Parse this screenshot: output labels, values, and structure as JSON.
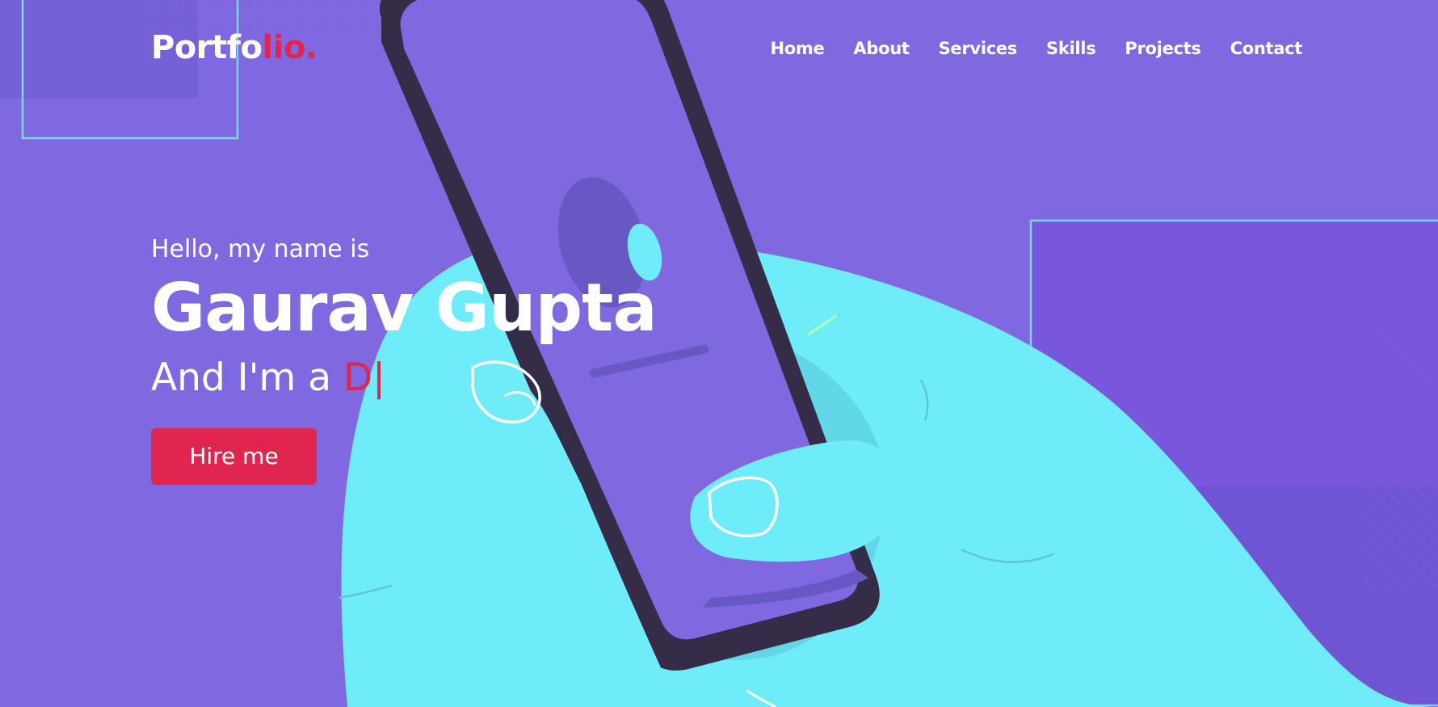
{
  "navbar": {
    "logo": {
      "part1": "Portfo",
      "part2": "lio."
    },
    "menu": [
      "Home",
      "About",
      "Services",
      "Skills",
      "Projects",
      "Contact"
    ]
  },
  "hero": {
    "greeting": "Hello, my name is",
    "name": "Gaurav Gupta",
    "role_prefix": "And I'm a ",
    "role_typed": "D",
    "caret": "|",
    "hire_button": "Hire me"
  },
  "colors": {
    "background": "#7f68e0",
    "accent": "#e0264f",
    "illustration_hand": "#6fecfa",
    "phone_frame": "#352d48",
    "text": "#ffffff"
  },
  "illustration": {
    "description_icon": "hand-holding-phone-illustration"
  }
}
